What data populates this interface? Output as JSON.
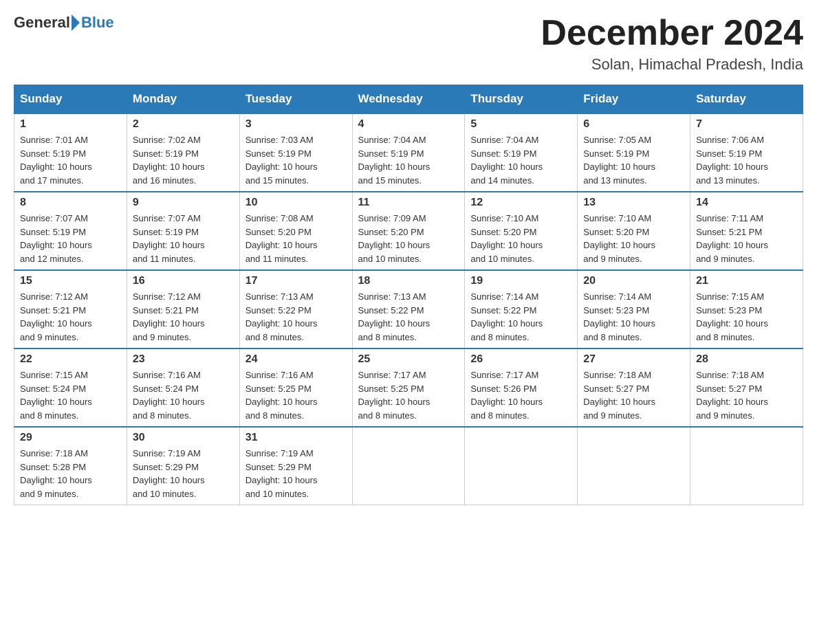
{
  "header": {
    "logo_general": "General",
    "logo_blue": "Blue",
    "month_title": "December 2024",
    "location": "Solan, Himachal Pradesh, India"
  },
  "days_of_week": [
    "Sunday",
    "Monday",
    "Tuesday",
    "Wednesday",
    "Thursday",
    "Friday",
    "Saturday"
  ],
  "weeks": [
    [
      {
        "day": "1",
        "sunrise": "7:01 AM",
        "sunset": "5:19 PM",
        "daylight": "10 hours and 17 minutes."
      },
      {
        "day": "2",
        "sunrise": "7:02 AM",
        "sunset": "5:19 PM",
        "daylight": "10 hours and 16 minutes."
      },
      {
        "day": "3",
        "sunrise": "7:03 AM",
        "sunset": "5:19 PM",
        "daylight": "10 hours and 15 minutes."
      },
      {
        "day": "4",
        "sunrise": "7:04 AM",
        "sunset": "5:19 PM",
        "daylight": "10 hours and 15 minutes."
      },
      {
        "day": "5",
        "sunrise": "7:04 AM",
        "sunset": "5:19 PM",
        "daylight": "10 hours and 14 minutes."
      },
      {
        "day": "6",
        "sunrise": "7:05 AM",
        "sunset": "5:19 PM",
        "daylight": "10 hours and 13 minutes."
      },
      {
        "day": "7",
        "sunrise": "7:06 AM",
        "sunset": "5:19 PM",
        "daylight": "10 hours and 13 minutes."
      }
    ],
    [
      {
        "day": "8",
        "sunrise": "7:07 AM",
        "sunset": "5:19 PM",
        "daylight": "10 hours and 12 minutes."
      },
      {
        "day": "9",
        "sunrise": "7:07 AM",
        "sunset": "5:19 PM",
        "daylight": "10 hours and 11 minutes."
      },
      {
        "day": "10",
        "sunrise": "7:08 AM",
        "sunset": "5:20 PM",
        "daylight": "10 hours and 11 minutes."
      },
      {
        "day": "11",
        "sunrise": "7:09 AM",
        "sunset": "5:20 PM",
        "daylight": "10 hours and 10 minutes."
      },
      {
        "day": "12",
        "sunrise": "7:10 AM",
        "sunset": "5:20 PM",
        "daylight": "10 hours and 10 minutes."
      },
      {
        "day": "13",
        "sunrise": "7:10 AM",
        "sunset": "5:20 PM",
        "daylight": "10 hours and 9 minutes."
      },
      {
        "day": "14",
        "sunrise": "7:11 AM",
        "sunset": "5:21 PM",
        "daylight": "10 hours and 9 minutes."
      }
    ],
    [
      {
        "day": "15",
        "sunrise": "7:12 AM",
        "sunset": "5:21 PM",
        "daylight": "10 hours and 9 minutes."
      },
      {
        "day": "16",
        "sunrise": "7:12 AM",
        "sunset": "5:21 PM",
        "daylight": "10 hours and 9 minutes."
      },
      {
        "day": "17",
        "sunrise": "7:13 AM",
        "sunset": "5:22 PM",
        "daylight": "10 hours and 8 minutes."
      },
      {
        "day": "18",
        "sunrise": "7:13 AM",
        "sunset": "5:22 PM",
        "daylight": "10 hours and 8 minutes."
      },
      {
        "day": "19",
        "sunrise": "7:14 AM",
        "sunset": "5:22 PM",
        "daylight": "10 hours and 8 minutes."
      },
      {
        "day": "20",
        "sunrise": "7:14 AM",
        "sunset": "5:23 PM",
        "daylight": "10 hours and 8 minutes."
      },
      {
        "day": "21",
        "sunrise": "7:15 AM",
        "sunset": "5:23 PM",
        "daylight": "10 hours and 8 minutes."
      }
    ],
    [
      {
        "day": "22",
        "sunrise": "7:15 AM",
        "sunset": "5:24 PM",
        "daylight": "10 hours and 8 minutes."
      },
      {
        "day": "23",
        "sunrise": "7:16 AM",
        "sunset": "5:24 PM",
        "daylight": "10 hours and 8 minutes."
      },
      {
        "day": "24",
        "sunrise": "7:16 AM",
        "sunset": "5:25 PM",
        "daylight": "10 hours and 8 minutes."
      },
      {
        "day": "25",
        "sunrise": "7:17 AM",
        "sunset": "5:25 PM",
        "daylight": "10 hours and 8 minutes."
      },
      {
        "day": "26",
        "sunrise": "7:17 AM",
        "sunset": "5:26 PM",
        "daylight": "10 hours and 8 minutes."
      },
      {
        "day": "27",
        "sunrise": "7:18 AM",
        "sunset": "5:27 PM",
        "daylight": "10 hours and 9 minutes."
      },
      {
        "day": "28",
        "sunrise": "7:18 AM",
        "sunset": "5:27 PM",
        "daylight": "10 hours and 9 minutes."
      }
    ],
    [
      {
        "day": "29",
        "sunrise": "7:18 AM",
        "sunset": "5:28 PM",
        "daylight": "10 hours and 9 minutes."
      },
      {
        "day": "30",
        "sunrise": "7:19 AM",
        "sunset": "5:29 PM",
        "daylight": "10 hours and 10 minutes."
      },
      {
        "day": "31",
        "sunrise": "7:19 AM",
        "sunset": "5:29 PM",
        "daylight": "10 hours and 10 minutes."
      },
      null,
      null,
      null,
      null
    ]
  ],
  "labels": {
    "sunrise": "Sunrise:",
    "sunset": "Sunset:",
    "daylight": "Daylight:"
  }
}
